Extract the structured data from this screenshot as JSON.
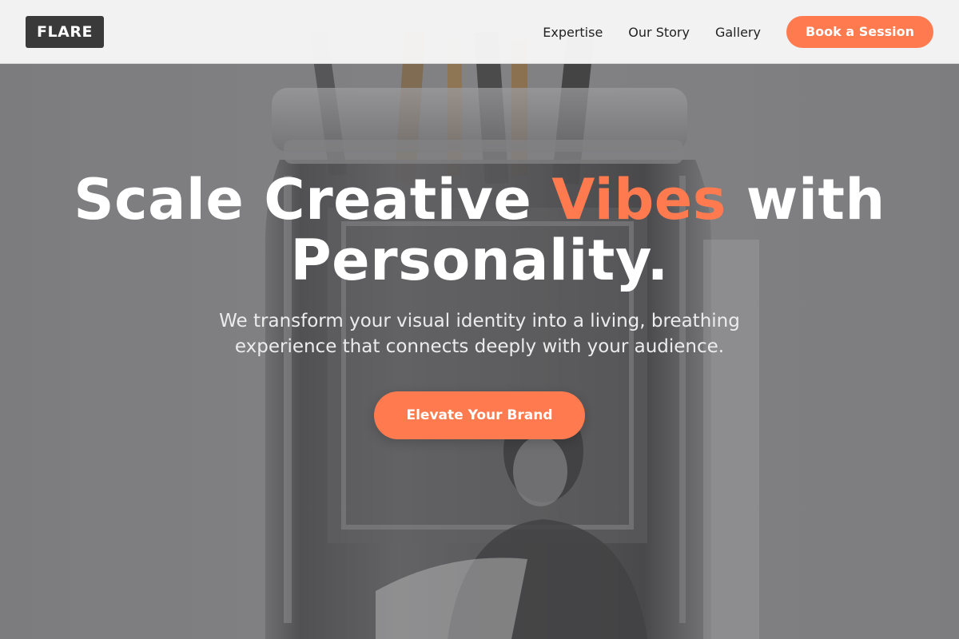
{
  "brand": {
    "logo_text": "FLARE"
  },
  "nav": {
    "links": [
      {
        "label": "Expertise"
      },
      {
        "label": "Our Story"
      },
      {
        "label": "Gallery"
      }
    ],
    "cta_label": "Book a Session"
  },
  "hero": {
    "headline_part1": "Scale Creative ",
    "headline_accent": "Vibes",
    "headline_part2": " with Personality.",
    "subheadline": "We transform your visual identity into a living, breathing experience that connects deeply with your audience.",
    "cta_label": "Elevate Your Brand",
    "background_image": "glass-jar-with-brushes-photo"
  },
  "colors": {
    "accent": "#ff7b4f",
    "navbar_bg": "#f6f6f6",
    "logo_bg": "#3a3a3a",
    "hero_text": "#ffffff"
  }
}
